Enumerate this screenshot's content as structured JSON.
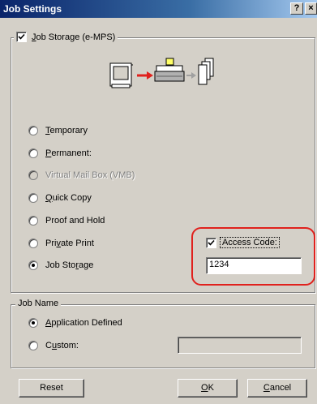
{
  "window": {
    "title": "Job Settings",
    "help_glyph": "?",
    "close_glyph": "×"
  },
  "job_storage_group": {
    "title": "Job Storage (e-MPS)",
    "title_hotkey": "J",
    "title_rest": "ob Storage (e-MPS)",
    "checked": true,
    "diagram_icons": [
      "computer-icon",
      "arrow-icon",
      "printer-icon",
      "arrow-icon",
      "documents-icon"
    ],
    "options": [
      {
        "label": "Temporary",
        "hk_pre": "",
        "hk": "T",
        "hk_post": "emporary",
        "selected": false,
        "enabled": true
      },
      {
        "label": "Permanent:",
        "hk_pre": "",
        "hk": "P",
        "hk_post": "ermanent:",
        "selected": false,
        "enabled": true
      },
      {
        "label": "Virtual Mail Box (VMB)",
        "hk_pre": "Virtual Mail Box (VMB)",
        "hk": "",
        "hk_post": "",
        "selected": false,
        "enabled": false
      },
      {
        "label": "Quick Copy",
        "hk_pre": "",
        "hk": "Q",
        "hk_post": "uick Copy",
        "selected": false,
        "enabled": true
      },
      {
        "label": "Proof and Hold",
        "hk_pre": "Proof and Hold",
        "hk": "",
        "hk_post": "",
        "selected": false,
        "enabled": true
      },
      {
        "label": "Private Print",
        "hk_pre": "Pri",
        "hk": "v",
        "hk_post": "ate Print",
        "selected": false,
        "enabled": true
      },
      {
        "label": "Job Storage",
        "hk_pre": "Job Sto",
        "hk": "r",
        "hk_post": "age",
        "selected": true,
        "enabled": true
      }
    ],
    "access_code": {
      "label": "Access Code:",
      "checked": true,
      "value": "1234"
    }
  },
  "job_name_group": {
    "title": "Job Name",
    "options": [
      {
        "label": "Application Defined",
        "hk_pre": "",
        "hk": "A",
        "hk_post": "pplication Defined",
        "selected": true
      },
      {
        "label": "Custom:",
        "hk_pre": "C",
        "hk": "u",
        "hk_post": "stom:",
        "selected": false
      }
    ],
    "custom_value": ""
  },
  "buttons": {
    "reset": "Reset",
    "ok_hk": "O",
    "ok_rest": "K",
    "cancel_hk": "C",
    "cancel_rest": "ancel"
  },
  "colors": {
    "dialog_bg": "#d4d0c8",
    "title_bar": "#0a246a",
    "highlight": "#e0211d",
    "arrow_red": "#e0211d",
    "arrow_gray": "#a0a0a0"
  }
}
